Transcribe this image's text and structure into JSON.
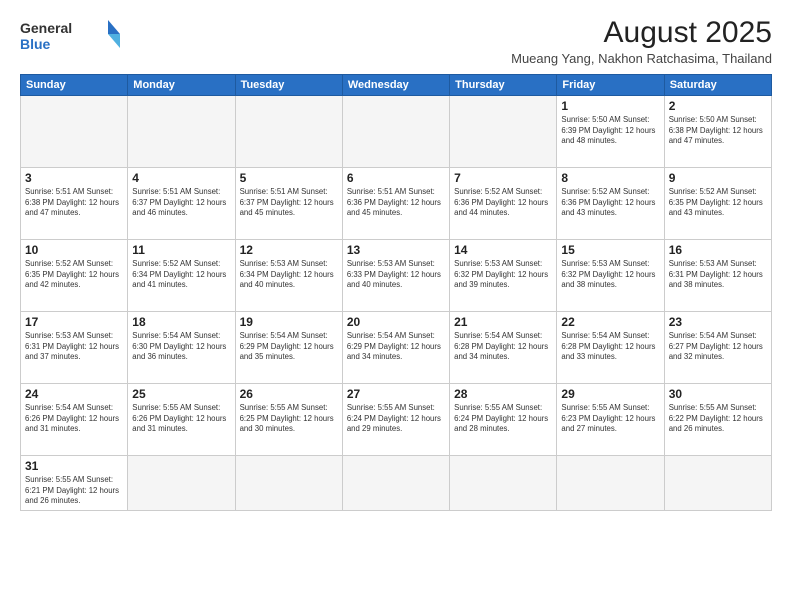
{
  "header": {
    "logo_general": "General",
    "logo_blue": "Blue",
    "month_year": "August 2025",
    "location": "Mueang Yang, Nakhon Ratchasima, Thailand"
  },
  "weekdays": [
    "Sunday",
    "Monday",
    "Tuesday",
    "Wednesday",
    "Thursday",
    "Friday",
    "Saturday"
  ],
  "days": [
    {
      "num": "",
      "info": ""
    },
    {
      "num": "",
      "info": ""
    },
    {
      "num": "",
      "info": ""
    },
    {
      "num": "",
      "info": ""
    },
    {
      "num": "",
      "info": ""
    },
    {
      "num": "1",
      "info": "Sunrise: 5:50 AM\nSunset: 6:39 PM\nDaylight: 12 hours\nand 48 minutes."
    },
    {
      "num": "2",
      "info": "Sunrise: 5:50 AM\nSunset: 6:38 PM\nDaylight: 12 hours\nand 47 minutes."
    },
    {
      "num": "3",
      "info": "Sunrise: 5:51 AM\nSunset: 6:38 PM\nDaylight: 12 hours\nand 47 minutes."
    },
    {
      "num": "4",
      "info": "Sunrise: 5:51 AM\nSunset: 6:37 PM\nDaylight: 12 hours\nand 46 minutes."
    },
    {
      "num": "5",
      "info": "Sunrise: 5:51 AM\nSunset: 6:37 PM\nDaylight: 12 hours\nand 45 minutes."
    },
    {
      "num": "6",
      "info": "Sunrise: 5:51 AM\nSunset: 6:36 PM\nDaylight: 12 hours\nand 45 minutes."
    },
    {
      "num": "7",
      "info": "Sunrise: 5:52 AM\nSunset: 6:36 PM\nDaylight: 12 hours\nand 44 minutes."
    },
    {
      "num": "8",
      "info": "Sunrise: 5:52 AM\nSunset: 6:36 PM\nDaylight: 12 hours\nand 43 minutes."
    },
    {
      "num": "9",
      "info": "Sunrise: 5:52 AM\nSunset: 6:35 PM\nDaylight: 12 hours\nand 43 minutes."
    },
    {
      "num": "10",
      "info": "Sunrise: 5:52 AM\nSunset: 6:35 PM\nDaylight: 12 hours\nand 42 minutes."
    },
    {
      "num": "11",
      "info": "Sunrise: 5:52 AM\nSunset: 6:34 PM\nDaylight: 12 hours\nand 41 minutes."
    },
    {
      "num": "12",
      "info": "Sunrise: 5:53 AM\nSunset: 6:34 PM\nDaylight: 12 hours\nand 40 minutes."
    },
    {
      "num": "13",
      "info": "Sunrise: 5:53 AM\nSunset: 6:33 PM\nDaylight: 12 hours\nand 40 minutes."
    },
    {
      "num": "14",
      "info": "Sunrise: 5:53 AM\nSunset: 6:32 PM\nDaylight: 12 hours\nand 39 minutes."
    },
    {
      "num": "15",
      "info": "Sunrise: 5:53 AM\nSunset: 6:32 PM\nDaylight: 12 hours\nand 38 minutes."
    },
    {
      "num": "16",
      "info": "Sunrise: 5:53 AM\nSunset: 6:31 PM\nDaylight: 12 hours\nand 38 minutes."
    },
    {
      "num": "17",
      "info": "Sunrise: 5:53 AM\nSunset: 6:31 PM\nDaylight: 12 hours\nand 37 minutes."
    },
    {
      "num": "18",
      "info": "Sunrise: 5:54 AM\nSunset: 6:30 PM\nDaylight: 12 hours\nand 36 minutes."
    },
    {
      "num": "19",
      "info": "Sunrise: 5:54 AM\nSunset: 6:29 PM\nDaylight: 12 hours\nand 35 minutes."
    },
    {
      "num": "20",
      "info": "Sunrise: 5:54 AM\nSunset: 6:29 PM\nDaylight: 12 hours\nand 34 minutes."
    },
    {
      "num": "21",
      "info": "Sunrise: 5:54 AM\nSunset: 6:28 PM\nDaylight: 12 hours\nand 34 minutes."
    },
    {
      "num": "22",
      "info": "Sunrise: 5:54 AM\nSunset: 6:28 PM\nDaylight: 12 hours\nand 33 minutes."
    },
    {
      "num": "23",
      "info": "Sunrise: 5:54 AM\nSunset: 6:27 PM\nDaylight: 12 hours\nand 32 minutes."
    },
    {
      "num": "24",
      "info": "Sunrise: 5:54 AM\nSunset: 6:26 PM\nDaylight: 12 hours\nand 31 minutes."
    },
    {
      "num": "25",
      "info": "Sunrise: 5:55 AM\nSunset: 6:26 PM\nDaylight: 12 hours\nand 31 minutes."
    },
    {
      "num": "26",
      "info": "Sunrise: 5:55 AM\nSunset: 6:25 PM\nDaylight: 12 hours\nand 30 minutes."
    },
    {
      "num": "27",
      "info": "Sunrise: 5:55 AM\nSunset: 6:24 PM\nDaylight: 12 hours\nand 29 minutes."
    },
    {
      "num": "28",
      "info": "Sunrise: 5:55 AM\nSunset: 6:24 PM\nDaylight: 12 hours\nand 28 minutes."
    },
    {
      "num": "29",
      "info": "Sunrise: 5:55 AM\nSunset: 6:23 PM\nDaylight: 12 hours\nand 27 minutes."
    },
    {
      "num": "30",
      "info": "Sunrise: 5:55 AM\nSunset: 6:22 PM\nDaylight: 12 hours\nand 26 minutes."
    },
    {
      "num": "31",
      "info": "Sunrise: 5:55 AM\nSunset: 6:21 PM\nDaylight: 12 hours\nand 26 minutes."
    }
  ]
}
